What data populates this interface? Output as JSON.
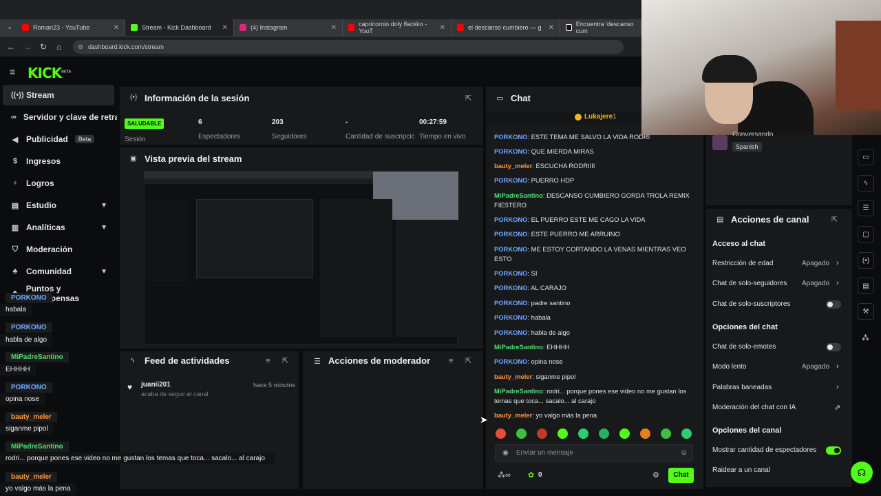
{
  "browser": {
    "tabs": [
      {
        "label": "Roman23 - YouTube",
        "color": "#ff0000"
      },
      {
        "label": "Stream - Kick Dashboard",
        "color": "#53fc18"
      },
      {
        "label": "(4) Instagram",
        "color": "#d62976"
      },
      {
        "label": "capricornio doly flackko - YouT",
        "color": "#ff0000"
      },
      {
        "label": "el descanso cumbiero — g",
        "color": "#ff0000"
      },
      {
        "label": "Encuentra 'descanso cum",
        "color": "#ffffff"
      }
    ],
    "url": "dashboard.kick.com/stream"
  },
  "brand": {
    "logo": "KICK",
    "logo_tag": "BETA"
  },
  "sidebar": {
    "items": [
      {
        "label": "Stream",
        "icon": "broadcast-icon"
      },
      {
        "label": "Servidor y clave de retransmisión",
        "icon": "link-icon"
      },
      {
        "label": "Publicidad",
        "icon": "megaphone-icon",
        "badge": "Beta"
      },
      {
        "label": "Ingresos",
        "icon": "money-icon"
      },
      {
        "label": "Logros",
        "icon": "trophy-icon"
      },
      {
        "label": "Estudio",
        "icon": "studio-icon"
      },
      {
        "label": "Analíticas",
        "icon": "chart-icon"
      },
      {
        "label": "Moderación",
        "icon": "shield-icon"
      },
      {
        "label": "Comunidad",
        "icon": "users-icon"
      },
      {
        "label": "Puntos y recompensas",
        "icon": "gift-icon"
      }
    ]
  },
  "session": {
    "title": "Información de la sesión",
    "status_badge": "SALUDABLE",
    "status_label": "Sesión",
    "stats": [
      {
        "value": "6",
        "label": "Espectadores"
      },
      {
        "value": "203",
        "label": "Seguidores"
      },
      {
        "value": "-",
        "label": "Cantidad de suscripciones"
      },
      {
        "value": "00:27:59",
        "label": "Tiempo en vivo"
      }
    ]
  },
  "preview": {
    "title": "Vista previa del stream"
  },
  "activity": {
    "title": "Feed de actividades",
    "items": [
      {
        "user": "juanii201",
        "time": "hace 5 minutos",
        "text": "acaba de seguir el canal"
      }
    ]
  },
  "mod_actions": {
    "title": "Acciones de moderador"
  },
  "chat": {
    "title": "Chat",
    "pinned_user": "Lukajere",
    "pinned_count": "1",
    "messages": [
      {
        "user": "PORKONO",
        "color": "blue",
        "text": "ESTE TEMA ME SALVO LA VIDA RODRI"
      },
      {
        "user": "PORKONO",
        "color": "blue",
        "text": "QUE MIERDA MIRAS"
      },
      {
        "user": "bauty_meler",
        "color": "orange",
        "text": "ESCUCHA RODRIIII"
      },
      {
        "user": "PORKONO",
        "color": "blue",
        "text": "PUERRO HDP"
      },
      {
        "user": "MiPadreSantino",
        "color": "green",
        "text": "DESCANSO CUMBIERO GORDA TROLA REMIX FIESTERO"
      },
      {
        "user": "PORKONO",
        "color": "blue",
        "text": "EL PUERRO ESTE ME CAGO LA VIDA"
      },
      {
        "user": "PORKONO",
        "color": "blue",
        "text": "ESTE PUERRO ME ARRUINO"
      },
      {
        "user": "PORKONO",
        "color": "blue",
        "text": "ME ESTOY CORTANDO LA VENAS MIENTRAS VEO ESTO"
      },
      {
        "user": "PORKONO",
        "color": "blue",
        "text": "SI"
      },
      {
        "user": "PORKONO",
        "color": "blue",
        "text": "AL CARAJO"
      },
      {
        "user": "PORKONO",
        "color": "blue",
        "text": "padre santino"
      },
      {
        "user": "PORKONO",
        "color": "blue",
        "text": "habala"
      },
      {
        "user": "PORKONO",
        "color": "blue",
        "text": "habla de algo"
      },
      {
        "user": "MiPadreSantino",
        "color": "green",
        "text": "EHHHH"
      },
      {
        "user": "PORKONO",
        "color": "blue",
        "text": "opina nose"
      },
      {
        "user": "bauty_meler",
        "color": "orange",
        "text": "siganme pipol"
      },
      {
        "user": "MiPadreSantino",
        "color": "green",
        "text": "rodri... porque pones ese video no me gustan los temas que toca... sacalo... al carajo"
      },
      {
        "user": "bauty_meler",
        "color": "orange",
        "text": "yo valgo más la pena"
      }
    ],
    "input_placeholder": "Enviar un mensaje",
    "points_value": "0",
    "send_label": "Chat"
  },
  "streamer_info": {
    "category": "Conversando",
    "language": "Spanish"
  },
  "channel_actions": {
    "title": "Acciones de canal",
    "sections": [
      {
        "heading": "Acceso al chat",
        "rows": [
          {
            "label": "Restricción de edad",
            "value": "Apagado",
            "kind": "select"
          },
          {
            "label": "Chat de solo-seguidores",
            "value": "Apagado",
            "kind": "select"
          },
          {
            "label": "Chat de solo-suscriptores",
            "kind": "toggle",
            "on": false
          }
        ]
      },
      {
        "heading": "Opciones del chat",
        "rows": [
          {
            "label": "Chat de solo-emotes",
            "kind": "toggle",
            "on": false
          },
          {
            "label": "Modo lento",
            "value": "Apagado",
            "kind": "select"
          },
          {
            "label": "Palabras baneadas",
            "kind": "link"
          },
          {
            "label": "Moderación del chat con IA",
            "kind": "external"
          }
        ]
      },
      {
        "heading": "Opciones del canal",
        "rows": [
          {
            "label": "Mostrar cantidad de espectadores",
            "kind": "toggle",
            "on": true
          },
          {
            "label": "Raidear a un canal",
            "kind": "link"
          }
        ]
      }
    ]
  },
  "overlay_chat": [
    {
      "user": "PORKONO",
      "color": "blue",
      "text": "habala"
    },
    {
      "user": "PORKONO",
      "color": "blue",
      "text": "habla de algo"
    },
    {
      "user": "MiPadreSantino",
      "color": "green",
      "text": "EHHHH"
    },
    {
      "user": "PORKONO",
      "color": "blue",
      "text": "opina nose"
    },
    {
      "user": "bauty_meler",
      "color": "orange",
      "text": "siganme pipol"
    },
    {
      "user": "MiPadreSantino",
      "color": "green",
      "text": "rodri... porque pones ese video no me gustan los temas que toca... sacalo... al carajo"
    },
    {
      "user": "bauty_meler",
      "color": "orange",
      "text": "yo valgo más la pena"
    }
  ],
  "colors": {
    "accent": "#53fc18",
    "blue_user": "#6fa8ff",
    "orange_user": "#ff9a3c",
    "green_user": "#4ee16b"
  }
}
